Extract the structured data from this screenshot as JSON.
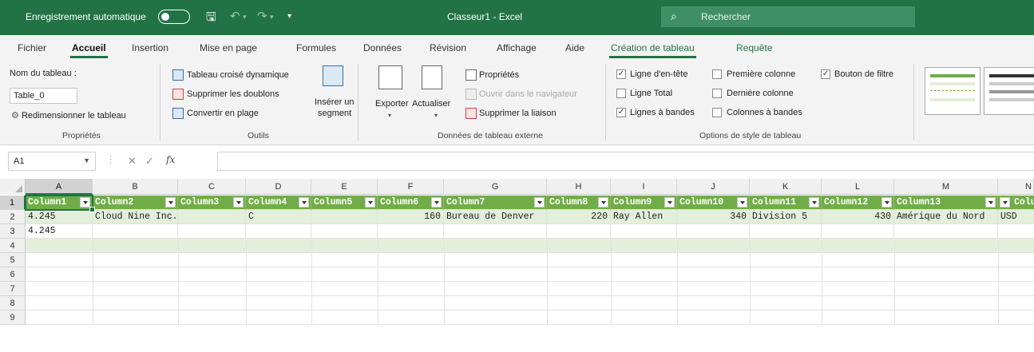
{
  "titlebar": {
    "autosave_label": "Enregistrement automatique",
    "doc_title": "Classeur1  -  Excel",
    "search_placeholder": "Rechercher"
  },
  "tabs": [
    {
      "label": "Fichier"
    },
    {
      "label": "Accueil"
    },
    {
      "label": "Insertion"
    },
    {
      "label": "Mise en page"
    },
    {
      "label": "Formules"
    },
    {
      "label": "Données"
    },
    {
      "label": "Révision"
    },
    {
      "label": "Affichage"
    },
    {
      "label": "Aide"
    },
    {
      "label": "Création de tableau"
    },
    {
      "label": "Requête"
    }
  ],
  "ribbon": {
    "proprietes": {
      "table_name_label": "Nom du tableau :",
      "table_name_value": "Table_0",
      "resize_label": "Redimensionner le tableau",
      "group_label": "Propriétés"
    },
    "outils": {
      "pivot": "Tableau croisé dynamique",
      "remove_dupes": "Supprimer les doublons",
      "convert_range": "Convertir en plage",
      "slicer_line1": "Insérer un",
      "slicer_line2": "segment",
      "group_label": "Outils"
    },
    "donnees_externe": {
      "export": "Exporter",
      "refresh": "Actualiser",
      "properties": "Propriétés",
      "open_browser": "Ouvrir dans le navigateur",
      "unlink": "Supprimer la liaison",
      "group_label": "Données de tableau externe"
    },
    "options_style": {
      "header_row": "Ligne d'en-tête",
      "total_row": "Ligne Total",
      "banded_rows": "Lignes à bandes",
      "first_col": "Première colonne",
      "last_col": "Dernière colonne",
      "banded_cols": "Colonnes à bandes",
      "filter_button": "Bouton de filtre",
      "group_label": "Options de style de tableau"
    }
  },
  "formulabar": {
    "namebox": "A1",
    "fx": "fx",
    "formula": ""
  },
  "grid": {
    "col_letters": [
      "A",
      "B",
      "C",
      "D",
      "E",
      "F",
      "G",
      "H",
      "I",
      "J",
      "K",
      "L",
      "M",
      "N"
    ],
    "row_numbers": [
      "1",
      "2",
      "3",
      "4",
      "5",
      "6",
      "7",
      "8",
      "9"
    ],
    "header_cells": [
      "Column1",
      "Column2",
      "Column3",
      "Column4",
      "Column5",
      "Column6",
      "Column7",
      "Column8",
      "Column9",
      "Column10",
      "Column11",
      "Column12",
      "Column13",
      "Colum"
    ],
    "row2": [
      "4.245",
      "Cloud Nine Inc.",
      "",
      "C",
      "",
      "160",
      "Bureau de Denver",
      "220",
      "Ray Allen",
      "340",
      "Division 5",
      "430",
      "Amérique du Nord",
      "USD"
    ],
    "row3": [
      "4.245",
      "",
      "",
      "",
      "",
      "",
      "",
      "",
      "",
      "",
      "",
      "",
      "",
      ""
    ]
  },
  "colors": {
    "brand": "#217346",
    "table_header": "#70AD47",
    "table_band": "#E2EFDA"
  }
}
